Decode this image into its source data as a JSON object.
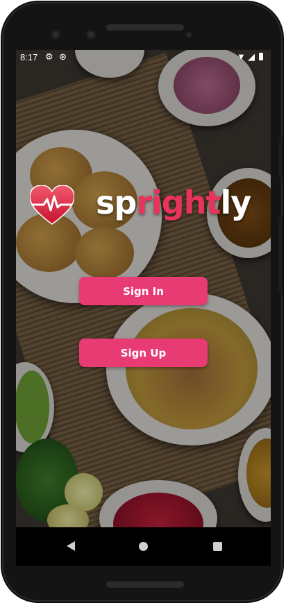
{
  "status_bar": {
    "time": "8:17",
    "left_icons": [
      "settings-icon",
      "sync-icon"
    ],
    "right_icons": [
      "wifi-icon",
      "signal-icon",
      "battery-icon"
    ]
  },
  "logo": {
    "part1": "sp",
    "part2": "right",
    "part3": "ly",
    "accent_color": "#e8335c"
  },
  "buttons": {
    "sign_in": "Sign In",
    "sign_up": "Sign Up",
    "color": "#e83a73"
  },
  "nav_bar": {
    "icons": [
      "back-icon",
      "home-icon",
      "recents-icon"
    ]
  }
}
